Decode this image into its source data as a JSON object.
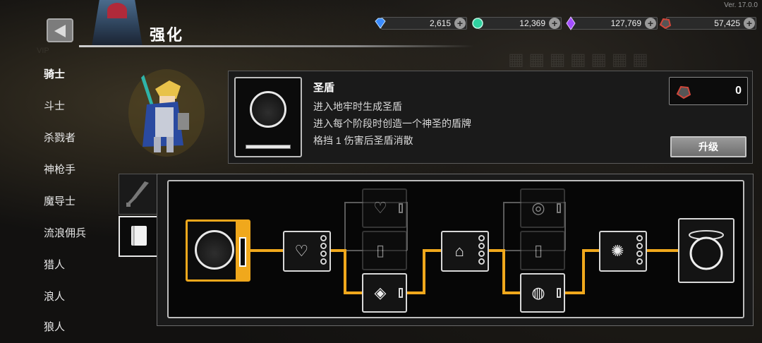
{
  "version": "Ver. 17.0.0",
  "header": {
    "title": "强化"
  },
  "currencies": [
    {
      "name": "diamond",
      "icon": "diamond-icon",
      "value": "2,615",
      "color": "#3a8bff"
    },
    {
      "name": "emerald",
      "icon": "green-gem-icon",
      "value": "12,369",
      "color": "#2fd1a0"
    },
    {
      "name": "crystal",
      "icon": "purple-crystal-icon",
      "value": "127,769",
      "color": "#a34dff"
    },
    {
      "name": "ore",
      "icon": "red-ore-icon",
      "value": "57,425",
      "color": "#d0463a"
    }
  ],
  "sidebar": {
    "items": [
      {
        "label": "骑士",
        "active": true
      },
      {
        "label": "斗士"
      },
      {
        "label": "杀戮者"
      },
      {
        "label": "神枪手"
      },
      {
        "label": "魔导士"
      },
      {
        "label": "流浪佣兵"
      },
      {
        "label": "猎人"
      },
      {
        "label": "浪人"
      },
      {
        "label": "狼人"
      }
    ]
  },
  "skill": {
    "name": "圣盾",
    "desc": [
      "进入地牢时生成圣盾",
      "进入每个阶段时创造一个神圣的盾牌",
      "格挡 1 伤害后圣盾消散"
    ],
    "cost": "0",
    "cost_icon": "red-ore-icon",
    "upgrade_label": "升级"
  },
  "tabs": [
    {
      "name": "sword-tab",
      "icon": "sword-icon"
    },
    {
      "name": "book-tab",
      "icon": "book-icon",
      "active": true
    }
  ],
  "accent_color": "#f0a81c"
}
